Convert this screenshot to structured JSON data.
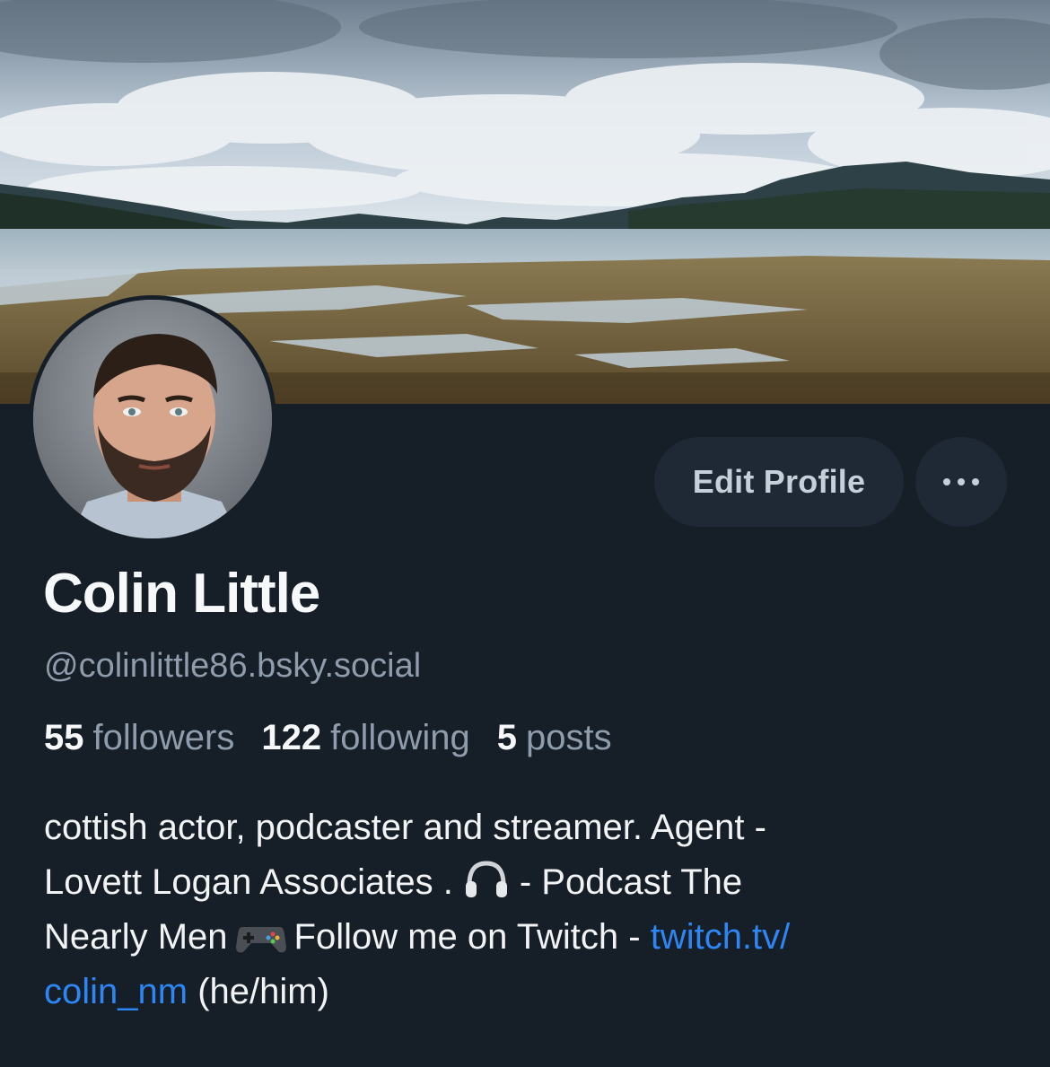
{
  "profile": {
    "display_name": "Colin Little",
    "handle": "@colinlittle86.bsky.social",
    "stats": {
      "followers_count": "55",
      "followers_label": "followers",
      "following_count": "122",
      "following_label": "following",
      "posts_count": "5",
      "posts_label": "posts"
    },
    "bio": {
      "line1": "cottish actor, podcaster and streamer. Agent -",
      "line2_a": "Lovett Logan Associates .",
      "line2_b": "- Podcast The",
      "line3_a": "Nearly Men",
      "line3_b": "Follow me on Twitch - ",
      "line3_link": "twitch.tv/",
      "line4_link": "colin_nm",
      "line4_b": " (he/him)"
    }
  },
  "actions": {
    "edit_profile_label": "Edit Profile",
    "more_icon": "ellipsis-icon"
  },
  "icons": {
    "headphones": "headphones-emoji",
    "gamepad": "gamepad-emoji"
  },
  "colors": {
    "background": "#161e27",
    "button_bg": "#1e2935",
    "muted_text": "#8f9cab",
    "link": "#2e86f5"
  }
}
